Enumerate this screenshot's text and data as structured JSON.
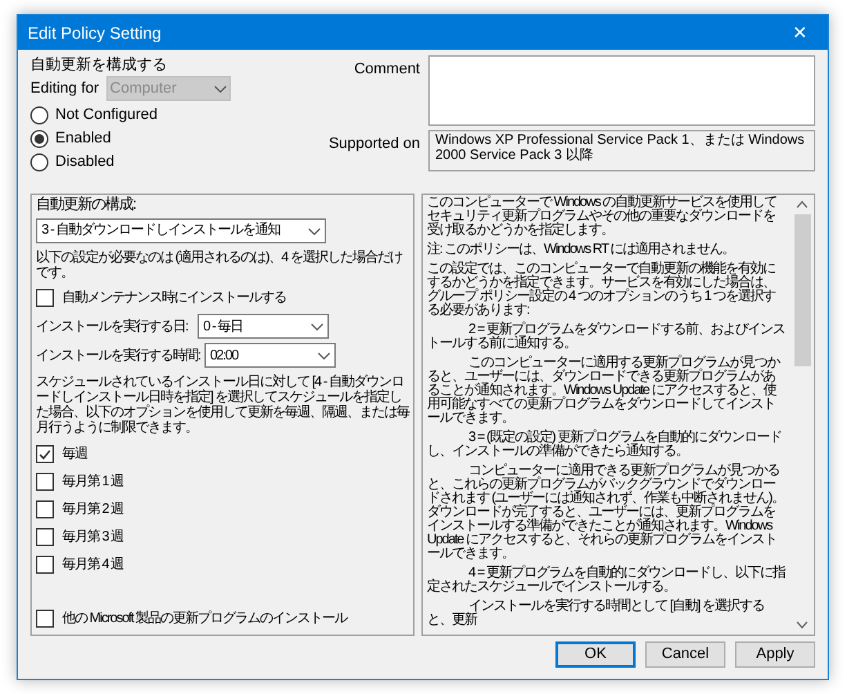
{
  "window": {
    "title": "Edit Policy Setting",
    "close": "✕"
  },
  "policy_name": "自動更新を構成する",
  "editing_for": {
    "label": "Editing for",
    "value": "Computer",
    "disabled": true
  },
  "state_options": [
    {
      "label": "Not Configured",
      "selected": false
    },
    {
      "label": "Enabled",
      "selected": true
    },
    {
      "label": "Disabled",
      "selected": false
    }
  ],
  "comment": {
    "label": "Comment"
  },
  "supported_on": {
    "label": "Supported on",
    "value": "Windows XP Professional Service Pack 1、または Windows 2000 Service Pack 3 以降"
  },
  "options": {
    "configure_label": "自動更新の構成:",
    "configure_value": "3 - 自動ダウンロードしインストールを通知",
    "note": "以下の設定が必要なのは (適用されるのは)、4 を選択した場合だけです。",
    "maintenance": {
      "label": "自動メンテナンス時にインストールする",
      "checked": false
    },
    "day": {
      "label": "インストールを実行する日:",
      "value": "0 - 毎日"
    },
    "time": {
      "label": "インストールを実行する時間:",
      "value": "02:00"
    },
    "schedule_note": "スケジュールされているインストール日に対して [4 - 自動ダウンロードしインストール日時を指定] を選択してスケジュールを指定した場合、以下のオプションを使用して更新を毎週、隔週、または毎月行うように制限できます。",
    "weeks": [
      {
        "label": "毎週",
        "checked": true
      },
      {
        "label": "毎月第 1 週",
        "checked": false
      },
      {
        "label": "毎月第 2 週",
        "checked": false
      },
      {
        "label": "毎月第 3 週",
        "checked": false
      },
      {
        "label": "毎月第 4 週",
        "checked": false
      }
    ],
    "other_products": {
      "label": "他の Microsoft 製品の更新プログラムのインストール",
      "checked": false
    }
  },
  "help": [
    {
      "text": "このコンピューターで Windows の自動更新サービスを使用してセキュリティ更新プログラムやその他の重要なダウンロードを受け取るかどうかを指定します。",
      "indented": false
    },
    {
      "text": "注: このポリシーは、Windows RT には適用されません。",
      "indented": false
    },
    {
      "text": "この設定では、このコンピューターで自動更新の機能を有効にするかどうかを指定できます。サービスを有効にした場合は、グループ ポリシー設定の 4 つのオプションのうち 1 つを選択する必要があります:",
      "indented": false
    },
    {
      "text": "2 = 更新プログラムをダウンロードする前、およびインストールする前に通知する。",
      "indented": true
    },
    {
      "text": "このコンピューターに適用する更新プログラムが見つかると、ユーザーには、ダウンロードできる更新プログラムがあることが通知されます。Windows Update にアクセスすると、使用可能なすべての更新プログラムをダウンロードしてインストールできます。",
      "indented": true
    },
    {
      "text": "3 = (既定の設定) 更新プログラムを自動的にダウンロードし、インストールの準備ができたら通知する。",
      "indented": true
    },
    {
      "text": "コンピューターに適用できる更新プログラムが見つかると、これらの更新プログラムがバックグラウンドでダウンロードされます (ユーザーには通知されず、作業も中断されません)。ダウンロードが完了すると、ユーザーには、更新プログラムをインストールする準備ができたことが通知されます。Windows Update にアクセスすると、それらの更新プログラムをインストールできます。",
      "indented": true
    },
    {
      "text": "4 = 更新プログラムを自動的にダウンロードし、以下に指定されたスケジュールでインストールする。",
      "indented": true
    },
    {
      "text": "インストールを実行する時間として [自動] を選択すると、更新",
      "indented": true
    }
  ],
  "buttons": [
    {
      "label": "OK",
      "default": true
    },
    {
      "label": "Cancel",
      "default": false
    },
    {
      "label": "Apply",
      "default": false
    }
  ]
}
